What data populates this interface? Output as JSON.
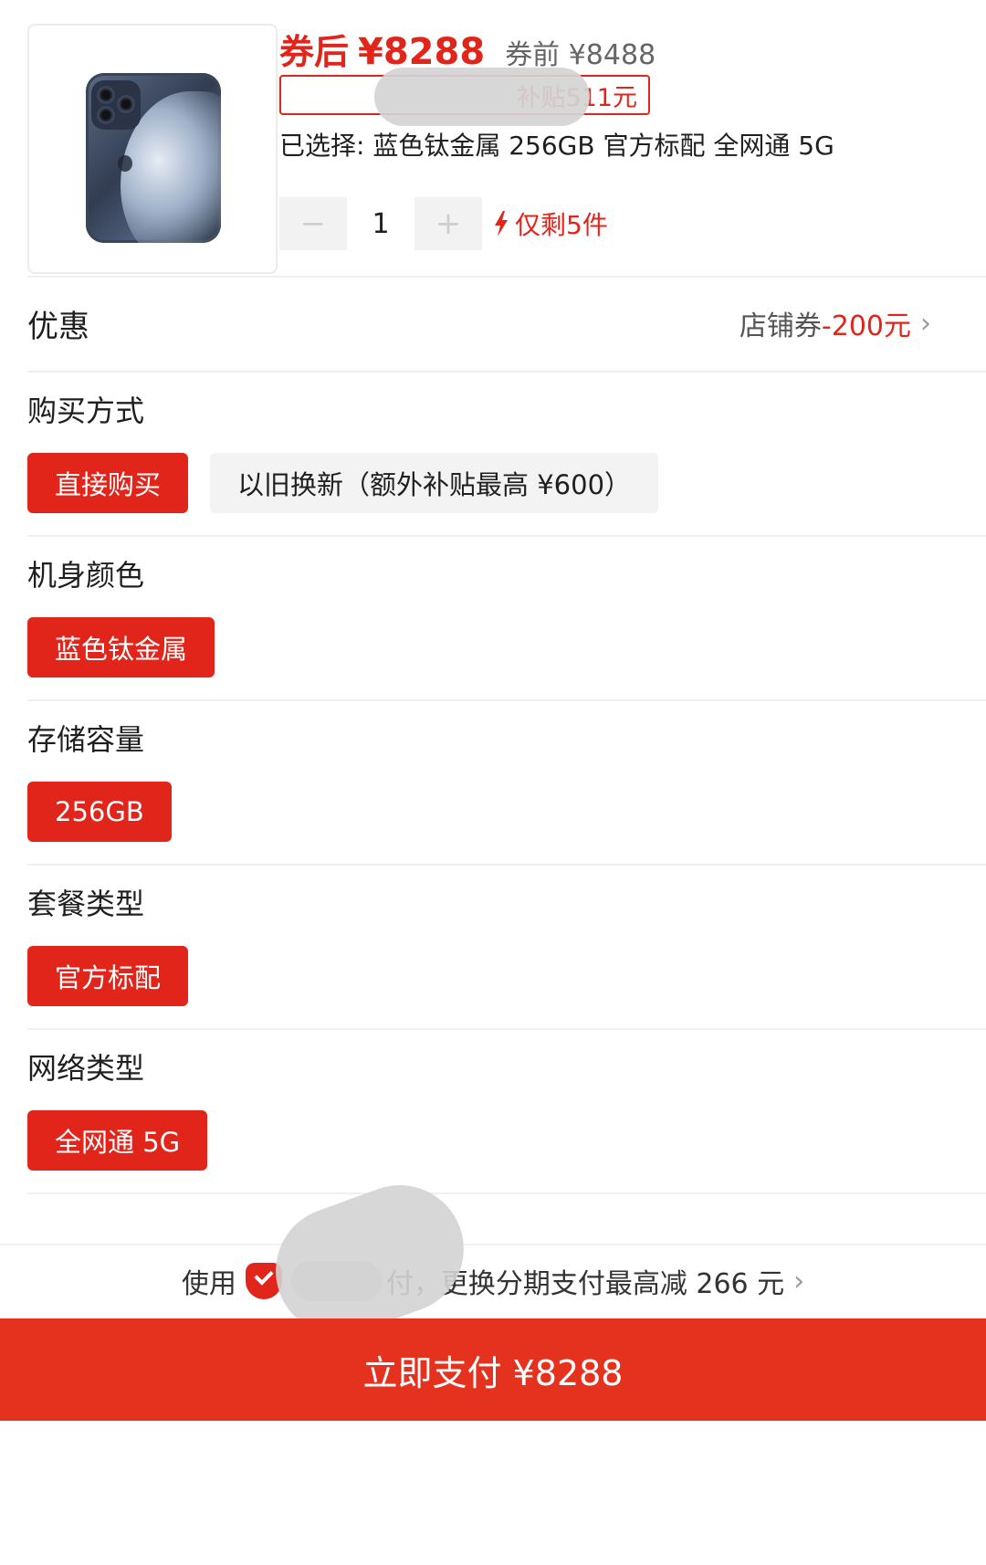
{
  "product": {
    "price_after_label": "券后",
    "price_after": "¥8288",
    "price_before": "券前 ¥8488",
    "subsidy_tag_visible": "补贴511元",
    "selected_summary": "已选择: 蓝色钛金属 256GB 官方标配 全网通 5G",
    "quantity": "1",
    "minus_label": "−",
    "plus_label": "+",
    "stock_text": "仅剩5件"
  },
  "coupon": {
    "title": "优惠",
    "label": "店铺券",
    "amount": "-200元"
  },
  "sections": {
    "purchase": {
      "title": "购买方式",
      "options": [
        "直接购买",
        "以旧换新（额外补贴最高 ¥600）"
      ],
      "selected": 0
    },
    "color": {
      "title": "机身颜色",
      "options": [
        "蓝色钛金属"
      ],
      "selected": 0
    },
    "storage": {
      "title": "存储容量",
      "options": [
        "256GB"
      ],
      "selected": 0
    },
    "package": {
      "title": "套餐类型",
      "options": [
        "官方标配"
      ],
      "selected": 0
    },
    "network": {
      "title": "网络类型",
      "options": [
        "全网通 5G"
      ],
      "selected": 0
    }
  },
  "bottom": {
    "hint_prefix": "使用",
    "hint_suffix": "付，更换分期支付最高减 266 元",
    "pay_button": "立即支付 ¥8288"
  },
  "colors": {
    "accent": "#e1251b",
    "pay_bar": "#e5321f",
    "option_bg": "#f3f3f3"
  }
}
